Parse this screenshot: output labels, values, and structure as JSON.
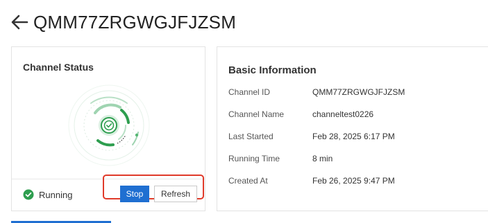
{
  "header": {
    "title": "QMM77ZRGWGJFJZSM",
    "back_icon": "arrow-left-icon"
  },
  "status_card": {
    "title": "Channel Status",
    "status_text": "Running",
    "status_icon": "check-circle-icon",
    "stop_label": "Stop",
    "refresh_label": "Refresh"
  },
  "info_card": {
    "title": "Basic Information",
    "rows": [
      {
        "label": "Channel ID",
        "value": "QMM77ZRGWGJFJZSM"
      },
      {
        "label": "Channel Name",
        "value": "channeltest0226"
      },
      {
        "label": "Last Started",
        "value": "Feb 28, 2025 6:17 PM"
      },
      {
        "label": "Running Time",
        "value": "8 min"
      },
      {
        "label": "Created At",
        "value": "Feb 26, 2025 9:47 PM"
      }
    ]
  },
  "colors": {
    "primary": "#1f6fd1",
    "running_green": "#2e9e4f",
    "highlight_red": "#e03a2a"
  }
}
